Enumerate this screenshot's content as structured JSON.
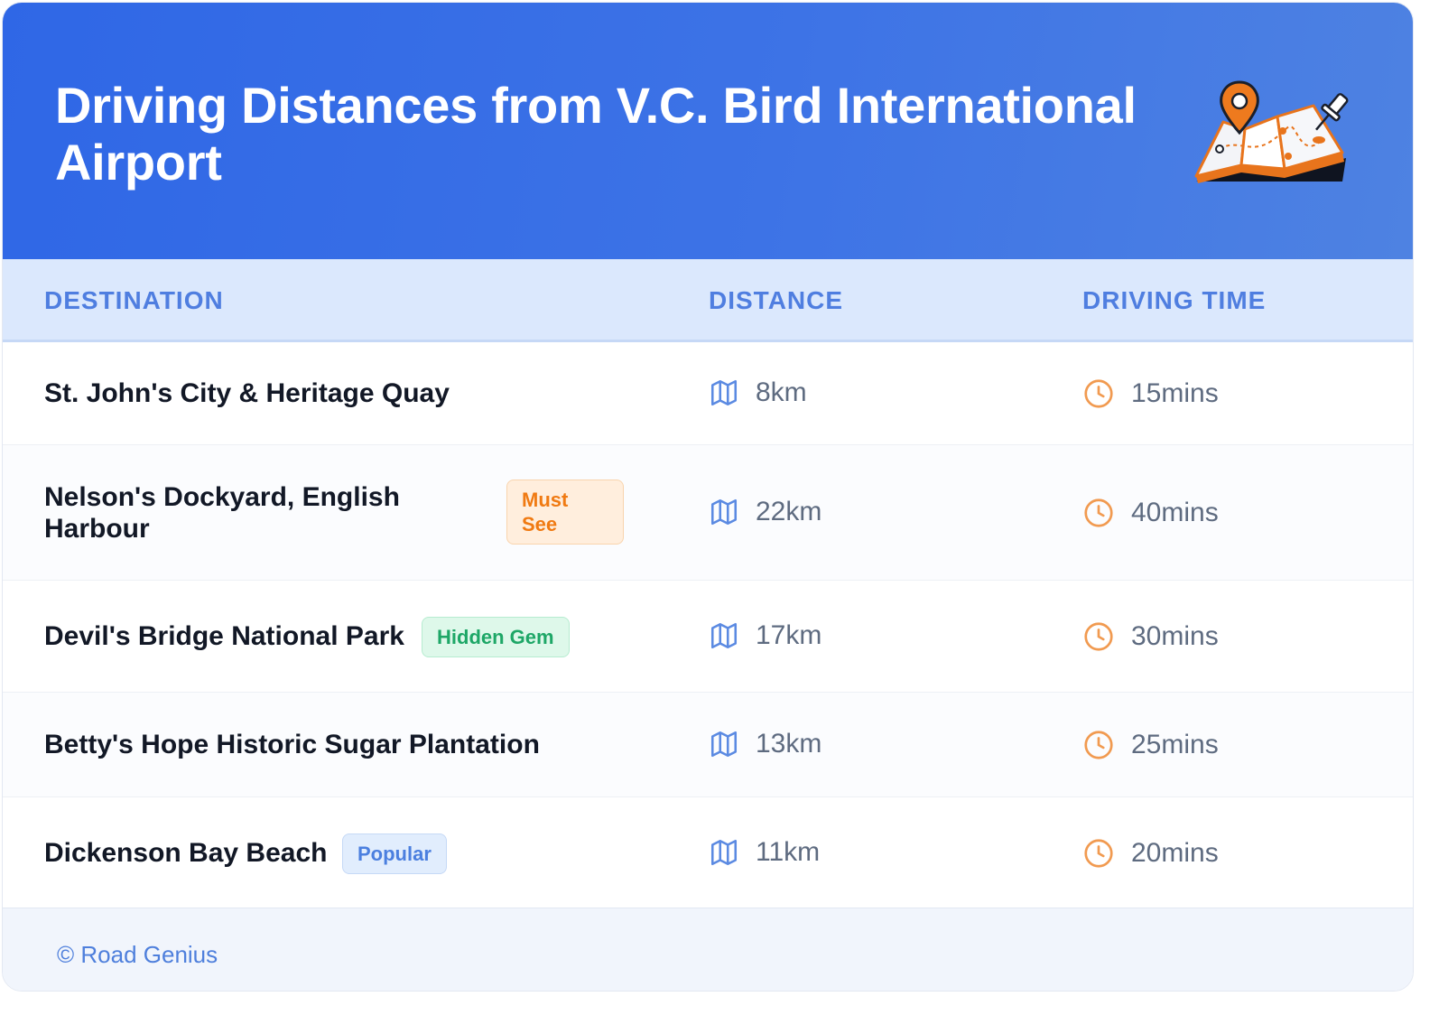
{
  "header": {
    "title": "Driving Distances from V.C. Bird International Airport",
    "illustration_icon": "map-with-pins-icon"
  },
  "columns": {
    "destination": "DESTINATION",
    "distance": "DISTANCE",
    "driving_time": "DRIVING TIME"
  },
  "rows": [
    {
      "destination": "St. John's City & Heritage Quay",
      "badge": "",
      "distance": "8km",
      "time": "15mins"
    },
    {
      "destination": "Nelson's Dockyard, English Harbour",
      "badge": "Must See",
      "distance": "22km",
      "time": "40mins"
    },
    {
      "destination": "Devil's Bridge National Park",
      "badge": "Hidden Gem",
      "distance": "17km",
      "time": "30mins"
    },
    {
      "destination": "Betty's Hope Historic Sugar Plantation",
      "badge": "",
      "distance": "13km",
      "time": "25mins"
    },
    {
      "destination": "Dickenson Bay Beach",
      "badge": "Popular",
      "distance": "11km",
      "time": "20mins"
    }
  ],
  "footer": {
    "copyright": "© Road Genius"
  },
  "colors": {
    "header_gradient_start": "#2f67e6",
    "header_gradient_end": "#4e82e2",
    "accent_blue": "#4f7ee0",
    "clock_orange": "#f19a50",
    "badge_must_see": "#f07a12",
    "badge_hidden_gem": "#1ea767",
    "badge_popular": "#4b7fdf"
  },
  "icons": {
    "distance": "map-icon",
    "time": "clock-icon"
  }
}
